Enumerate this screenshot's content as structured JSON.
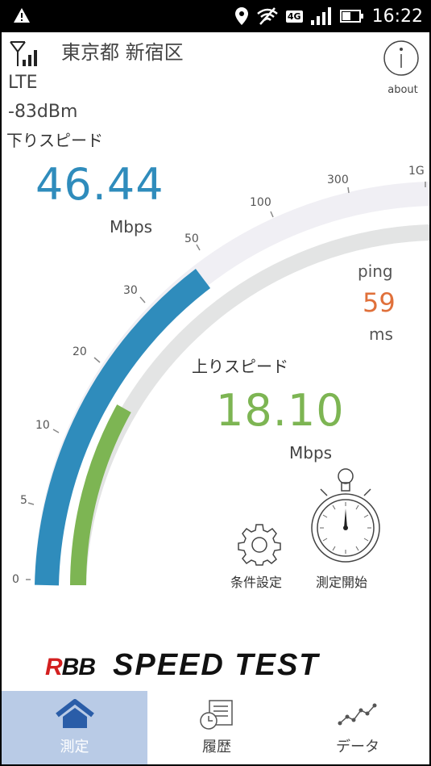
{
  "status_bar": {
    "time": "16:22",
    "network_badge": "4G",
    "icons": [
      "warning-icon",
      "location-icon",
      "no-wifi-icon",
      "4g-icon",
      "signal-icon",
      "battery-icon"
    ]
  },
  "header": {
    "location": "東京都 新宿区",
    "network_type": "LTE",
    "signal_strength": "-83dBm",
    "about_label": "about"
  },
  "download": {
    "label": "下りスピード",
    "value": "46.44",
    "unit": "Mbps",
    "color": "#2f8cbc"
  },
  "upload": {
    "label": "上りスピード",
    "value": "18.10",
    "unit": "Mbps",
    "color": "#7db553"
  },
  "ping": {
    "label": "ping",
    "value": "59",
    "unit": "ms",
    "color": "#e0703a"
  },
  "gauge": {
    "scale_labels": [
      "0",
      "5",
      "10",
      "20",
      "30",
      "50",
      "100",
      "300",
      "1G"
    ],
    "download_level_mbps": 46.44,
    "upload_level_mbps": 18.1
  },
  "controls": {
    "settings_label": "条件設定",
    "start_label": "測定開始"
  },
  "logo": {
    "brand": "RBB",
    "product": "SPEED TEST"
  },
  "tabs": [
    {
      "label": "測定",
      "icon": "home-icon",
      "active": true
    },
    {
      "label": "履歴",
      "icon": "history-icon",
      "active": false
    },
    {
      "label": "データ",
      "icon": "data-chart-icon",
      "active": false
    }
  ]
}
